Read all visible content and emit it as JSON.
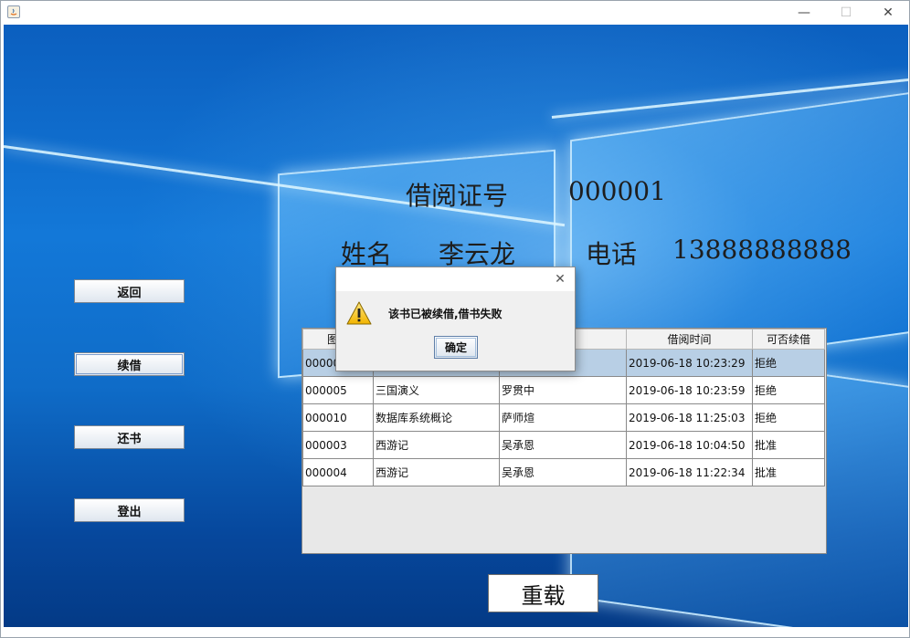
{
  "window": {
    "minimize_icon": "minimize-icon",
    "maximize_icon": "maximize-icon",
    "close_icon": "close-icon",
    "minimize_glyph": "—",
    "maximize_glyph": "☐",
    "close_glyph": "✕"
  },
  "card": {
    "card_label": "借阅证号",
    "card_value": "000001",
    "name_label": "姓名",
    "name_value": "李云龙",
    "phone_label": "电话",
    "phone_value": "13888888888"
  },
  "sidebar": {
    "back": "返回",
    "renew": "续借",
    "return_book": "还书",
    "logout": "登出"
  },
  "table": {
    "headers": [
      "图书",
      "",
      "",
      "借阅时间",
      "可否续借"
    ],
    "rows": [
      [
        "000001",
        "",
        "",
        "2019-06-18 10:23:29",
        "拒绝"
      ],
      [
        "000005",
        "三国演义",
        "罗贯中",
        "2019-06-18 10:23:59",
        "拒绝"
      ],
      [
        "000010",
        "数据库系统概论",
        "萨师煊",
        "2019-06-18 11:25:03",
        "拒绝"
      ],
      [
        "000003",
        "西游记",
        "吴承恩",
        "2019-06-18 10:04:50",
        "批准"
      ],
      [
        "000004",
        "西游记",
        "吴承恩",
        "2019-06-18 11:22:34",
        "批准"
      ]
    ]
  },
  "reload_button": "重载",
  "dialog": {
    "message": "该书已被续借,借书失败",
    "ok": "确定",
    "close_glyph": "✕",
    "icon": "warning-icon"
  },
  "colors": {
    "selected_row": "#b8cfe5",
    "background_blue": "#1378d8"
  }
}
